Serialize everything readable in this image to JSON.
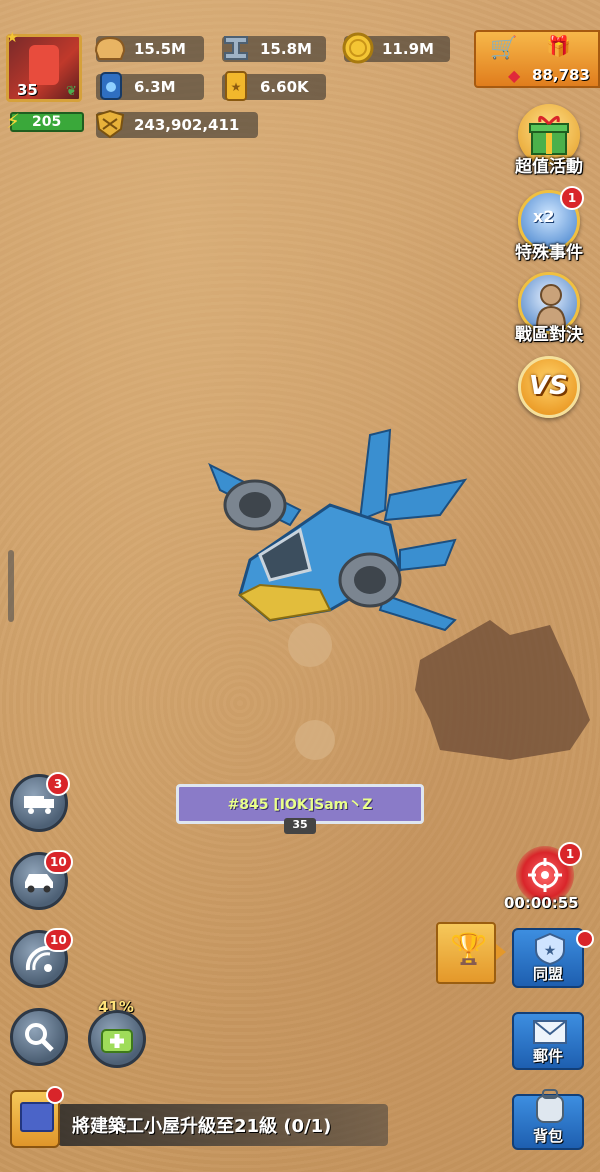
{
  "player": {
    "level": "35",
    "energy": "205",
    "power": "243,902,411"
  },
  "resources": {
    "food": "15.5M",
    "steel": "15.8M",
    "gold": "11.9M",
    "oil": "6.3M",
    "cards": "6.60K"
  },
  "shop": {
    "gems": "88,783"
  },
  "events": [
    {
      "label": "超值活動",
      "icon": "gift-icon"
    },
    {
      "label": "特殊事件",
      "icon": "special-event-icon",
      "badge": "1"
    },
    {
      "label": "戰區對決",
      "icon": "soldier-icon"
    },
    {
      "label": "VS",
      "icon": "vs-icon"
    }
  ],
  "base_banner": {
    "name": "#845 [IOK]Sam丶Z",
    "level": "35"
  },
  "left_buttons": [
    {
      "icon": "truck-icon",
      "badge": "3"
    },
    {
      "icon": "car-icon",
      "badge": "10"
    },
    {
      "icon": "radar-icon",
      "badge": "10"
    },
    {
      "icon": "magnifier-icon"
    }
  ],
  "heal": {
    "percent": "41%"
  },
  "threat": {
    "badge": "1",
    "timer": "00:00:55"
  },
  "alliance": {
    "label": "同盟"
  },
  "mail": {
    "label": "郵件"
  },
  "backpack": {
    "label": "背包"
  },
  "quest": {
    "text": "將建築工小屋升級至21級 (0/1)"
  },
  "colors": {
    "accent_red": "#d9252a",
    "quest_bg": "#3a3a3a",
    "banner": "#8a7bc8"
  }
}
